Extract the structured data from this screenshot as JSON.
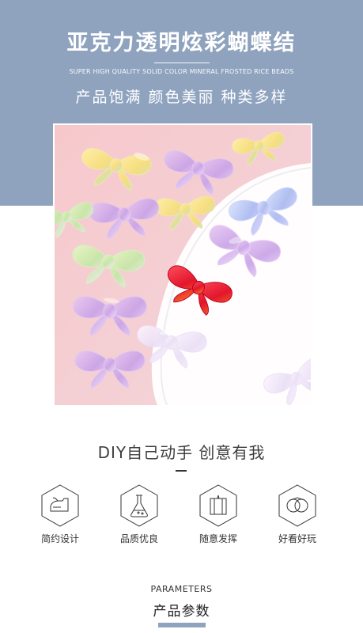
{
  "header": {
    "title": "亚克力透明炫彩蝴蝶结",
    "subtitle_en": "SUPER HIGH QUALITY SOLID COLOR MINERAL FROSTED RICE BEADS",
    "slogan": "产品饱满 颜色美丽 种类多样"
  },
  "diy": {
    "text": "DIY自己动手 创意有我",
    "dash": "—"
  },
  "features": [
    {
      "label": "简约设计",
      "icon": "iron-icon"
    },
    {
      "label": "品质优良",
      "icon": "flask-icon"
    },
    {
      "label": "随意发挥",
      "icon": "cards-icon"
    },
    {
      "label": "好看好玩",
      "icon": "rings-icon"
    }
  ],
  "parameters": {
    "title_en": "PARAMETERS",
    "title_cn": "产品参数"
  },
  "colors": {
    "band": "#8fa3bf",
    "text": "#333333"
  }
}
